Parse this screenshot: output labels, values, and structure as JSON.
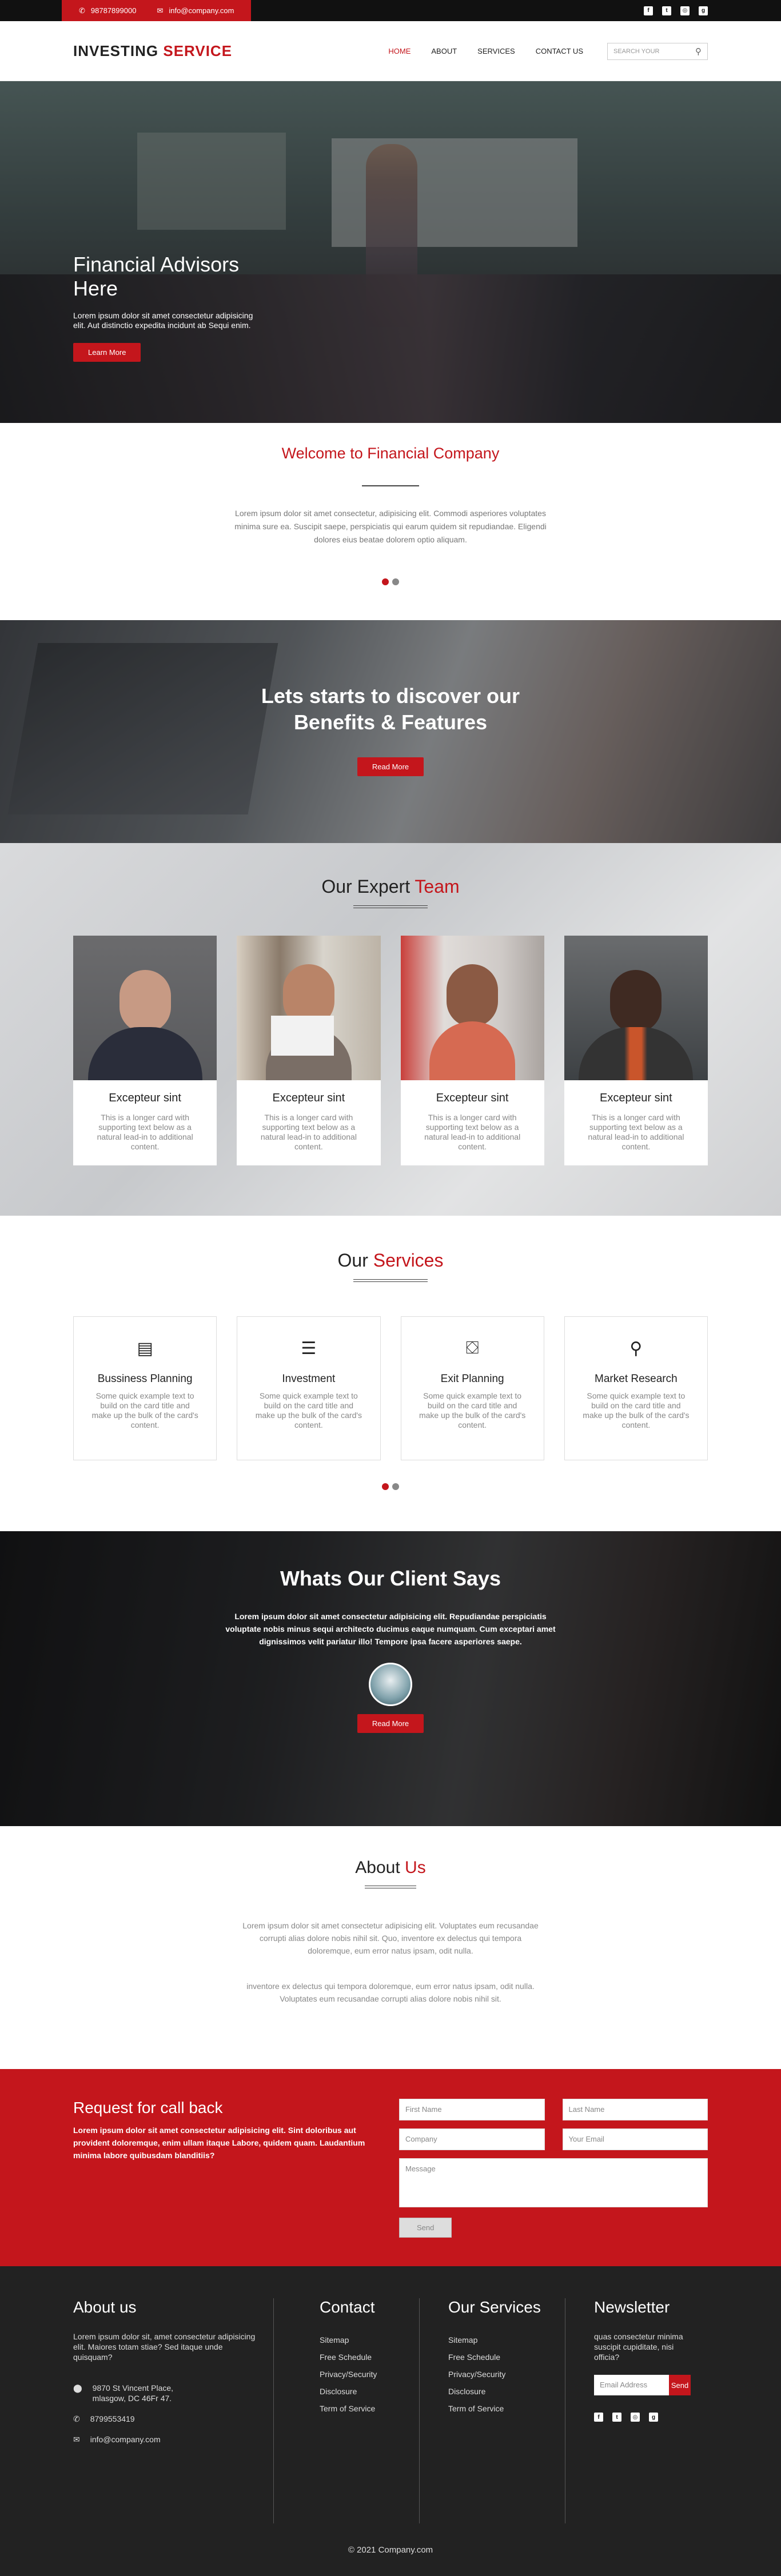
{
  "topbar": {
    "phone": "98787899000",
    "email": "info@company.com",
    "social": [
      {
        "name": "facebook-icon",
        "glyph": "f"
      },
      {
        "name": "twitter-icon",
        "glyph": "t"
      },
      {
        "name": "instagram-icon",
        "glyph": "◎"
      },
      {
        "name": "googleplus-icon",
        "glyph": "g"
      }
    ]
  },
  "header": {
    "logo_part1": "INVESTING",
    "logo_part2": "SERVICE",
    "nav": [
      "HOME",
      "ABOUT",
      "SERVICES",
      "CONTACT US"
    ],
    "search_placeholder": "SEARCH YOUR"
  },
  "hero": {
    "title": "Financial Advisors Here",
    "text": "Lorem ipsum dolor sit amet consectetur adipisicing elit. Aut distinctio expedita incidunt ab Sequi enim.",
    "button": "Learn More"
  },
  "welcome": {
    "title": "Welcome to Financial Company",
    "text": "Lorem ipsum dolor sit amet consectetur, adipisicing elit. Commodi asperiores voluptates minima sure ea. Suscipit saepe, perspiciatis qui earum quidem sit repudiandae. Eligendi dolores eius beatae dolorem optio aliquam."
  },
  "benefits": {
    "line1": "Lets starts to discover our",
    "line2": "Benefits & Features",
    "button": "Read More"
  },
  "team": {
    "title_a": "Our Expert",
    "title_b": "Team",
    "members": [
      {
        "name": "Excepteur sint",
        "text": "This is a longer card with supporting text below as a natural lead-in to additional content."
      },
      {
        "name": "Excepteur sint",
        "text": "This is a longer card with supporting text below as a natural lead-in to additional content."
      },
      {
        "name": "Excepteur sint",
        "text": "This is a longer card with supporting text below as a natural lead-in to additional content."
      },
      {
        "name": "Excepteur sint",
        "text": "This is a longer card with supporting text below as a natural lead-in to additional content."
      }
    ]
  },
  "services": {
    "title_a": "Our",
    "title_b": "Services",
    "items": [
      {
        "icon": "document-icon",
        "glyph": "📄",
        "title": "Bussiness Planning",
        "text": "Some quick example text to build on the card title and make up the bulk of the card's content."
      },
      {
        "icon": "coins-icon",
        "glyph": "🪙",
        "title": "Investment",
        "text": "Some quick example text to build on the card title and make up the bulk of the card's content."
      },
      {
        "icon": "exit-icon",
        "glyph": "🚪",
        "title": "Exit Planning",
        "text": "Some quick example text to build on the card title and make up the bulk of the card's content."
      },
      {
        "icon": "research-icon",
        "glyph": "🔍",
        "title": "Market Research",
        "text": "Some quick example text to build on the card title and make up the bulk of the card's content."
      }
    ]
  },
  "client": {
    "title": "Whats Our Client Says",
    "text": "Lorem ipsum dolor sit amet consectetur adipisicing elit. Repudiandae perspiciatis voluptate nobis minus sequi architecto ducimus eaque numquam. Cum exceptari amet dignissimos velit pariatur illo! Tempore ipsa facere asperiores saepe.",
    "button": "Read More"
  },
  "about": {
    "title_a": "About",
    "title_b": "Us",
    "text1": "Lorem ipsum dolor sit amet consectetur adipisicing elit. Voluptates eum recusandae corrupti alias dolore nobis nihil sit. Quo, inventore ex delectus qui tempora doloremque, eum error natus ipsam, odit nulla.",
    "text2": "inventore ex delectus qui tempora doloremque, eum error natus ipsam, odit nulla. Voluptates eum recusandae corrupti alias dolore nobis nihil sit."
  },
  "callback": {
    "title": "Request for call back",
    "text": "Lorem ipsum dolor sit amet consectetur adipisicing elit. Sint doloribus aut provident doloremque, enim ullam itaque Labore, quidem quam. Laudantium minima labore quibusdam blanditiis?",
    "first_name": "First Name",
    "last_name": "Last Name",
    "company": "Company",
    "email": "Your Email",
    "message": "Message",
    "send": "Send"
  },
  "footer": {
    "about_title": "About us",
    "about_text": "Lorem ipsum dolor sit, amet consectetur adipisicing elit. Maiores totam stiae? Sed itaque unde quisquam?",
    "address": "9870 St Vincent Place, mlasgow, DC 46Fr 47.",
    "phone": "8799553419",
    "email": "info@company.com",
    "contact_title": "Contact",
    "contact_links": [
      "Sitemap",
      "Free Schedule",
      "Privacy/Security",
      "Disclosure",
      "Term of Service"
    ],
    "services_title": "Our Services",
    "services_links": [
      "Sitemap",
      "Free Schedule",
      "Privacy/Security",
      "Disclosure",
      "Term of Service"
    ],
    "newsletter_title": "Newsletter",
    "newsletter_text": "quas consectetur minima suscipit cupiditate, nisi officia?",
    "newsletter_placeholder": "Email Address",
    "newsletter_button": "Send",
    "copyright": "© 2021 Company.com"
  },
  "colors": {
    "accent": "#c4161c",
    "dark": "#222222"
  }
}
